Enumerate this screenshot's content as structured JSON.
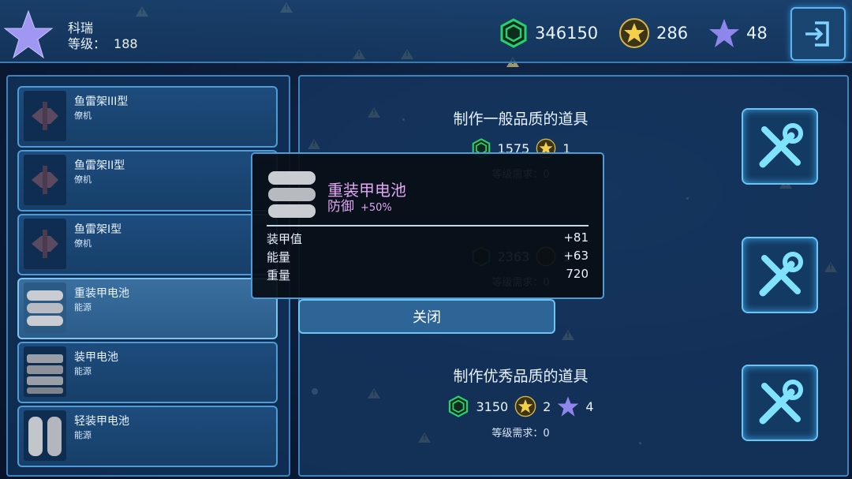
{
  "player": {
    "name": "科瑞",
    "level_label": "等级：",
    "level": "188"
  },
  "resources": [
    {
      "icon": "credit-icon",
      "value": "346150"
    },
    {
      "icon": "gold-star-icon",
      "value": "286"
    },
    {
      "icon": "purple-star-icon",
      "value": "48"
    }
  ],
  "items": [
    {
      "name": "鱼雷架III型",
      "type": "僚机",
      "icon": "torpedo-rack-icon"
    },
    {
      "name": "鱼雷架II型",
      "type": "僚机",
      "icon": "torpedo-rack-icon"
    },
    {
      "name": "鱼雷架I型",
      "type": "僚机",
      "icon": "torpedo-rack-icon"
    },
    {
      "name": "重装甲电池",
      "type": "能源",
      "icon": "heavy-battery-icon"
    },
    {
      "name": "装甲电池",
      "type": "能源",
      "icon": "battery-icon"
    },
    {
      "name": "轻装甲电池",
      "type": "能源",
      "icon": "light-battery-icon"
    }
  ],
  "crafting": [
    {
      "title": "制作一般品质的道具",
      "credits": "1575",
      "stars": "1",
      "requirement": "等级需求：0"
    },
    {
      "title": "",
      "credits": "2363",
      "stars": "1",
      "requirement": "等级需求：0"
    },
    {
      "title": "制作优秀品质的道具",
      "credits": "3150",
      "stars": "2",
      "purple": "4",
      "requirement": "等级需求：0"
    }
  ],
  "popup": {
    "title": "重装甲电池",
    "sub": "防御",
    "bonus": "+50%",
    "stats": [
      {
        "label": "装甲值",
        "value": "+81"
      },
      {
        "label": "能量",
        "value": "+63"
      },
      {
        "label": "重量",
        "value": "720"
      }
    ]
  },
  "close_label": "关闭",
  "colors": {
    "accent": "#4e9bd6",
    "popup_text": "#e2a6f5",
    "credit": "#28d26a",
    "gold": "#e6c14a",
    "purple": "#8f86ec"
  }
}
